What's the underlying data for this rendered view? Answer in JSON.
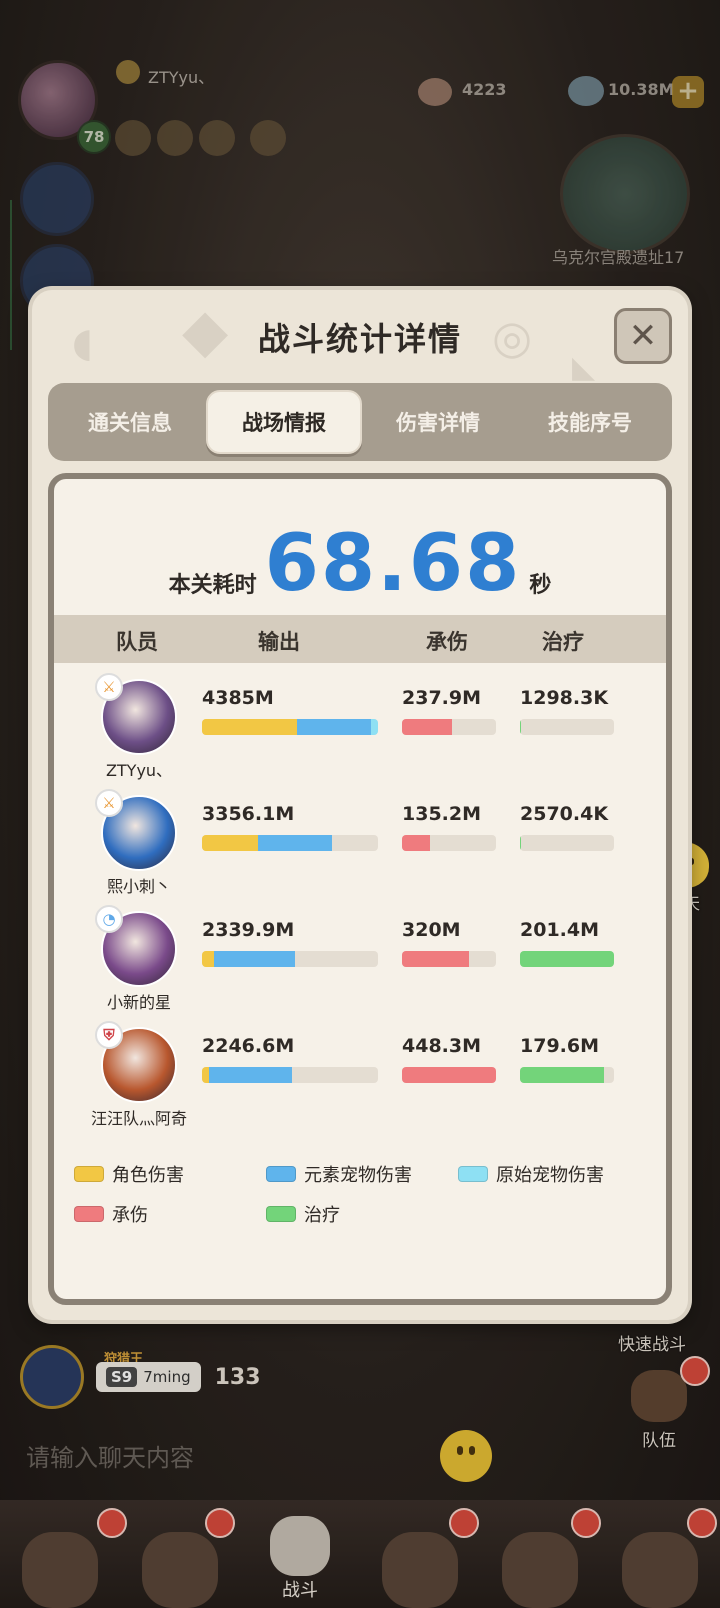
{
  "hud": {
    "player_name": "ZTYyu、",
    "level": "78",
    "gems": "4223",
    "gold": "10.38M",
    "plus_label": "+",
    "map_name": "乌克尔宫殿遗址17"
  },
  "side": {
    "chat_label": "聊天",
    "quick_battle_label": "快速战斗",
    "team_label": "队伍"
  },
  "hunt": {
    "title": "狩猎王",
    "season": "S9",
    "name": "7ming",
    "value": "133"
  },
  "chat_input": {
    "placeholder": "请输入聊天内容"
  },
  "bottom_nav": {
    "battle_label": "战斗"
  },
  "modal": {
    "title": "战斗统计详情",
    "close_symbol": "✕",
    "tabs": [
      {
        "label": "通关信息",
        "active": false
      },
      {
        "label": "战场情报",
        "active": true
      },
      {
        "label": "伤害详情",
        "active": false
      },
      {
        "label": "技能序号",
        "active": false
      }
    ],
    "time": {
      "label": "本关耗时",
      "value": "68.68",
      "unit": "秒"
    },
    "columns": {
      "member": "队员",
      "output": "输出",
      "tank": "承伤",
      "heal": "治疗"
    },
    "rows": [
      {
        "name": "ZTYyu、",
        "class_icon": "sword-class-icon",
        "output": "4385M",
        "tank": "237.9M",
        "heal": "1298.3K",
        "output_split": {
          "role": 0.54,
          "element_pet": 0.42,
          "origin_pet": 0.04
        },
        "tank_fill": 0.53,
        "heal_fill": 0.01,
        "avatar_color": "#6d4f87"
      },
      {
        "name": "熙小刺丶",
        "class_icon": "sword-class-icon",
        "output": "3356.1M",
        "tank": "135.2M",
        "heal": "2570.4K",
        "output_split": {
          "role": 0.32,
          "element_pet": 0.42,
          "origin_pet": 0.0
        },
        "tank_fill": 0.3,
        "heal_fill": 0.01,
        "avatar_color": "#2f6dbf"
      },
      {
        "name": "小新的星",
        "class_icon": "element-class-icon",
        "output": "2339.9M",
        "tank": "320M",
        "heal": "201.4M",
        "output_split": {
          "role": 0.07,
          "element_pet": 0.46,
          "origin_pet": 0.0
        },
        "tank_fill": 0.71,
        "heal_fill": 1.0,
        "avatar_color": "#7a4a8a"
      },
      {
        "name": "汪汪队灬阿奇",
        "class_icon": "shield-class-icon",
        "output": "2246.6M",
        "tank": "448.3M",
        "heal": "179.6M",
        "output_split": {
          "role": 0.04,
          "element_pet": 0.47,
          "origin_pet": 0.0
        },
        "tank_fill": 1.0,
        "heal_fill": 0.89,
        "avatar_color": "#b8572e"
      }
    ],
    "legend": [
      {
        "label": "角色伤害",
        "color": "#f2c744"
      },
      {
        "label": "元素宠物伤害",
        "color": "#5fb4ec"
      },
      {
        "label": "原始宠物伤害",
        "color": "#8ee0f3"
      },
      {
        "label": "承伤",
        "color": "#ef7b7e"
      },
      {
        "label": "治疗",
        "color": "#73d47a"
      }
    ]
  },
  "colors": {
    "role": "#f2c744",
    "element_pet": "#5fb4ec",
    "origin_pet": "#8ee0f3",
    "tank": "#ef7b7e",
    "heal": "#73d47a",
    "time_value": "#2f7fd1"
  }
}
